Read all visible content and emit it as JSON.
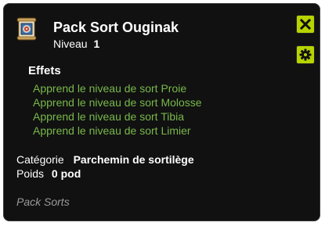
{
  "item": {
    "name": "Pack Sort Ouginak",
    "level_label": "Niveau",
    "level_value": "1",
    "icon": "spell-scroll-icon"
  },
  "buttons": {
    "close_icon": "close-icon",
    "settings_icon": "gear-icon",
    "accent_color": "#b7d400"
  },
  "effects": {
    "title": "Effets",
    "items": [
      "Apprend le niveau de sort Proie",
      "Apprend le niveau de sort Molosse",
      "Apprend le niveau de sort Tibia",
      "Apprend le niveau de sort Limier"
    ],
    "color": "#78b84a"
  },
  "properties": {
    "category_label": "Catégorie",
    "category_value": "Parchemin de sortilège",
    "weight_label": "Poids",
    "weight_value": "0 pod"
  },
  "footer": {
    "set_name": "Pack Sorts"
  }
}
